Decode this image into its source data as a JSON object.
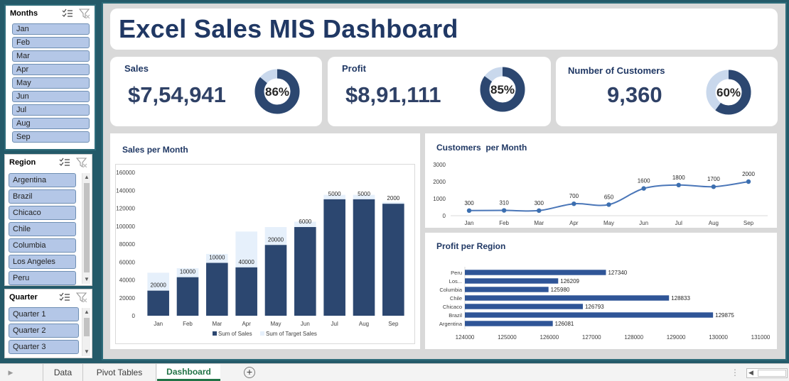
{
  "slicers": {
    "months": {
      "title": "Months",
      "items": [
        "Jan",
        "Feb",
        "Mar",
        "Apr",
        "May",
        "Jun",
        "Jul",
        "Aug",
        "Sep"
      ]
    },
    "region": {
      "title": "Region",
      "items": [
        "Argentina",
        "Brazil",
        "Chicaco",
        "Chile",
        "Columbia",
        "Los Angeles",
        "Peru"
      ]
    },
    "quarter": {
      "title": "Quarter",
      "items": [
        "Quarter 1",
        "Quarter 2",
        "Quarter 3"
      ]
    }
  },
  "header": {
    "title": "Excel Sales MIS Dashboard"
  },
  "kpis": {
    "sales": {
      "label": "Sales",
      "value": "$7,54,941",
      "pct_label": "86%",
      "pct": 0.86
    },
    "profit": {
      "label": "Profit",
      "value": "$8,91,111",
      "pct_label": "85%",
      "pct": 0.85
    },
    "customers": {
      "label": "Number of Customers",
      "value": "9,360",
      "pct_label": "60%",
      "pct": 0.6
    }
  },
  "colors": {
    "dark": "#2c4770",
    "light": "#c9d8ec",
    "target": "#e6f0fb",
    "line": "#4a76b8",
    "accent": "#217346"
  },
  "chart_data": [
    {
      "type": "bar",
      "title": "Sales per Month",
      "categories": [
        "Jan",
        "Feb",
        "Mar",
        "Apr",
        "May",
        "Jun",
        "Jul",
        "Aug",
        "Sep"
      ],
      "series": [
        {
          "name": "Sum of Sales",
          "values": [
            28000,
            43000,
            59000,
            54000,
            79000,
            99000,
            130000,
            130000,
            125000
          ]
        },
        {
          "name": "Sum of Target Sales",
          "values": [
            20000,
            10000,
            10000,
            40000,
            20000,
            6000,
            5000,
            5000,
            2000
          ]
        }
      ],
      "data_labels": [
        "20000",
        "10000",
        "10000",
        "40000",
        "20000",
        "6000",
        "5000",
        "5000",
        "2000"
      ],
      "ylim": [
        0,
        160000
      ],
      "yticks": [
        "0",
        "20000",
        "40000",
        "60000",
        "80000",
        "100000",
        "120000",
        "140000",
        "160000"
      ],
      "stacked": true,
      "legend": "bottom"
    },
    {
      "type": "line",
      "title": "Customers  per Month",
      "categories": [
        "Jan",
        "Feb",
        "Mar",
        "Apr",
        "May",
        "Jun",
        "Jul",
        "Aug",
        "Sep"
      ],
      "values": [
        300,
        310,
        300,
        700,
        650,
        1600,
        1800,
        1700,
        2000
      ],
      "ylim": [
        0,
        3000
      ],
      "yticks": [
        "0",
        "1000",
        "2000",
        "3000"
      ]
    },
    {
      "type": "bar",
      "orientation": "horizontal",
      "title": "Profit per Region",
      "categories": [
        "Peru",
        "Los...",
        "Columbia",
        "Chile",
        "Chicaco",
        "Brazil",
        "Argentina"
      ],
      "values": [
        127340,
        126209,
        125980,
        128833,
        126793,
        129875,
        126081
      ],
      "xlim": [
        124000,
        131000
      ],
      "xticks": [
        "124000",
        "125000",
        "126000",
        "127000",
        "128000",
        "129000",
        "130000",
        "131000"
      ]
    }
  ],
  "tabs": {
    "data": "Data",
    "pivot": "Pivot Tables",
    "dashboard": "Dashboard",
    "add": "+"
  }
}
